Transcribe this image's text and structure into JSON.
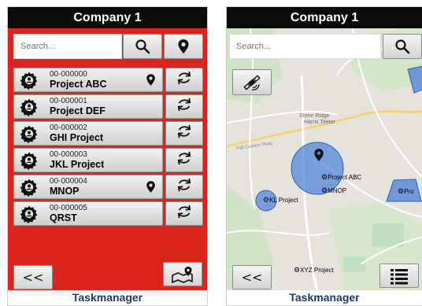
{
  "left": {
    "title": "Company 1",
    "search_placeholder": "Search...",
    "projects": [
      {
        "id": "00-000000",
        "name": "Project ABC",
        "pinned": true
      },
      {
        "id": "00-000001",
        "name": "Project DEF",
        "pinned": false
      },
      {
        "id": "00-000002",
        "name": "GHI Project",
        "pinned": false
      },
      {
        "id": "00-000003",
        "name": "JKL Project",
        "pinned": false
      },
      {
        "id": "00-000004",
        "name": "MNOP",
        "pinned": true
      },
      {
        "id": "00-000005",
        "name": "QRST",
        "pinned": false
      }
    ],
    "back_label": "<<",
    "footer": "Taskmanager"
  },
  "right": {
    "title": "Company 1",
    "search_placeholder": "Search...",
    "map_labels": {
      "project_abc": "Project ABC",
      "mnop": "MNOP",
      "kl_project": "KL Project",
      "xyz_project": "XYZ Project",
      "partial_project": "Pro",
      "stone_ridge": "Stone Ridge",
      "harris_teeter": "Harris Teeter",
      "fall_cedars": "Fall Cedars Pkwy"
    },
    "back_label": "<<",
    "footer": "Taskmanager"
  },
  "colors": {
    "panel_red": "#d9251c",
    "titlebar": "#0a0a0a",
    "footer_text": "#1f3a6b",
    "zone_fill": "#4a7fd8"
  },
  "icons": [
    "search-icon",
    "location-pin-icon",
    "gear-icon",
    "sync-icon",
    "map-pin-icon",
    "satellite-icon",
    "list-icon"
  ]
}
